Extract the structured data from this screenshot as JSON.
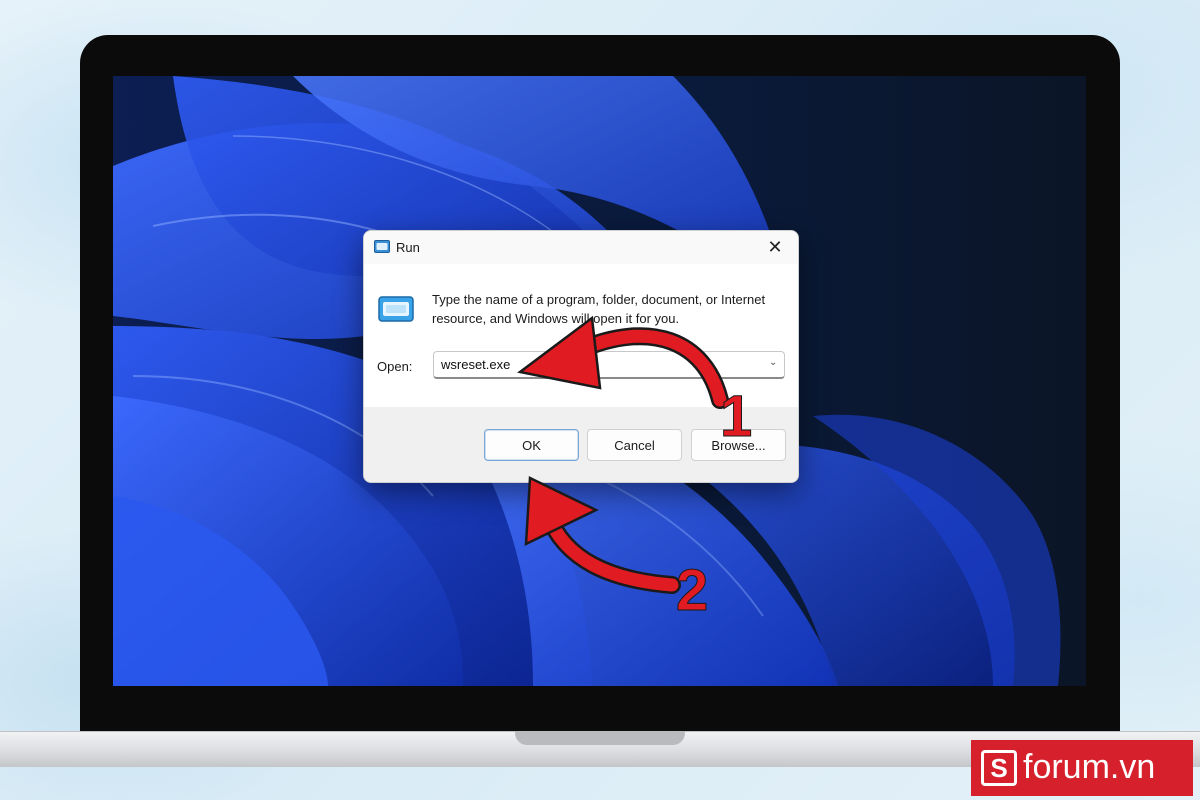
{
  "dialog": {
    "title": "Run",
    "close_glyph": "✕",
    "description": "Type the name of a program, folder, document, or Internet resource, and Windows will open it for you.",
    "open_label": "Open:",
    "open_value": "wsreset.exe",
    "ok_label": "OK",
    "cancel_label": "Cancel",
    "browse_label": "Browse..."
  },
  "annotations": {
    "step1": "1",
    "step2": "2",
    "color": "#e11b22"
  },
  "brand": {
    "logo_letter": "S",
    "name": "forum.vn"
  },
  "icons": {
    "dialog_icon": "run-icon",
    "close": "close-icon",
    "dropdown": "chevron-down-icon"
  }
}
